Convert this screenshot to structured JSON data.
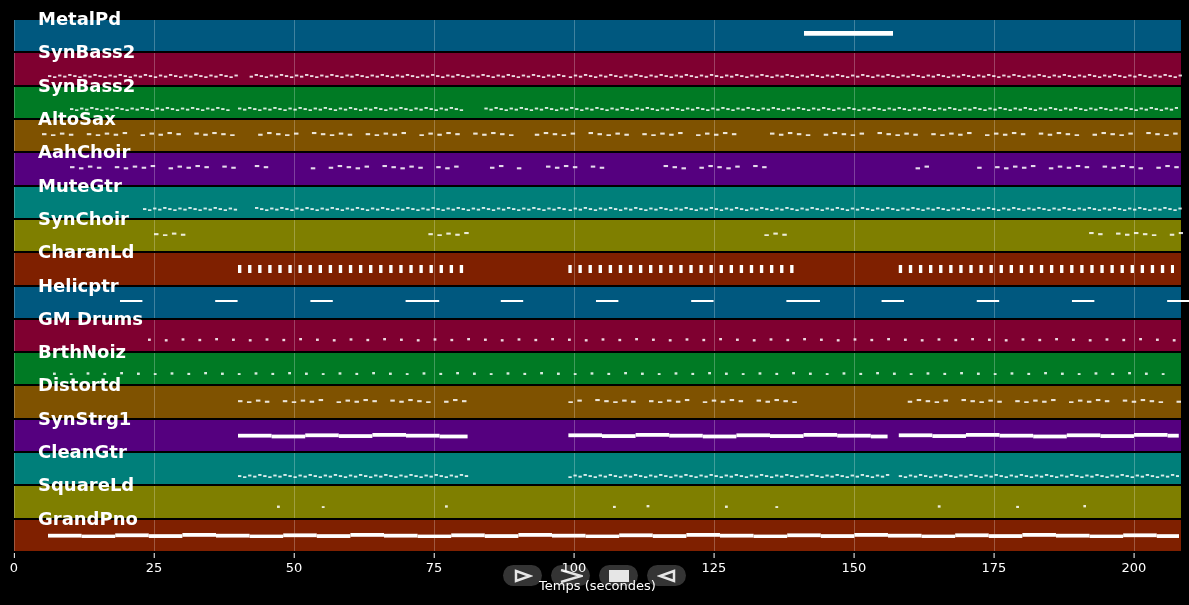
{
  "chart": {
    "tracks": [
      {
        "name": "MetalPd",
        "color": "#00587f",
        "kind": "pad"
      },
      {
        "name": "SynBass2",
        "color": "#7f0030",
        "kind": "dense"
      },
      {
        "name": "SynBass2",
        "color": "#007a24",
        "kind": "dense"
      },
      {
        "name": "AltoSax",
        "color": "#7f5200",
        "kind": "dots"
      },
      {
        "name": "AahChoir",
        "color": "#55007f",
        "kind": "dots"
      },
      {
        "name": "MuteGtr",
        "color": "#007f7a",
        "kind": "dense"
      },
      {
        "name": "SynChoir",
        "color": "#7f7f00",
        "kind": "dots"
      },
      {
        "name": "CharanLd",
        "color": "#7f2000",
        "kind": "bars"
      },
      {
        "name": "Helicptr",
        "color": "#00587f",
        "kind": "dashes"
      },
      {
        "name": "GM Drums",
        "color": "#7f0030",
        "kind": "ticks"
      },
      {
        "name": "BrthNoiz",
        "color": "#007a24",
        "kind": "ticks"
      },
      {
        "name": "Distortd",
        "color": "#7f5200",
        "kind": "dots"
      },
      {
        "name": "SynStrg1",
        "color": "#55007f",
        "kind": "long"
      },
      {
        "name": "CleanGtr",
        "color": "#007f7a",
        "kind": "dense"
      },
      {
        "name": "SquareLd",
        "color": "#7f7f00",
        "kind": "ticks"
      },
      {
        "name": "GrandPno",
        "color": "#7f2000",
        "kind": "long"
      }
    ],
    "xticks": [
      "0",
      "25",
      "50",
      "75",
      "100",
      "125",
      "150",
      "175",
      "200"
    ],
    "xlabel": "Temps (secondes)"
  },
  "controls": [
    {
      "kind": "play"
    },
    {
      "kind": "forward"
    },
    {
      "kind": "stop"
    },
    {
      "kind": "back"
    }
  ]
}
